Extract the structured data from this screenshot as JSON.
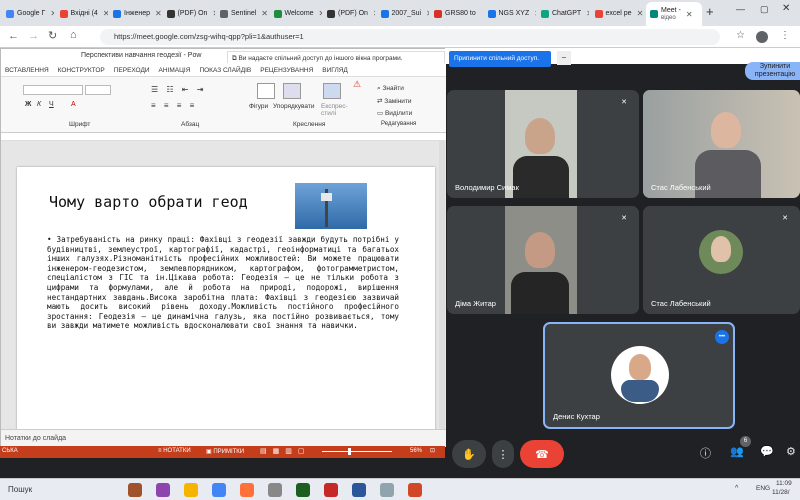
{
  "browser": {
    "tabs": [
      {
        "label": "Google Г",
        "color": "#4285f4"
      },
      {
        "label": "Вхідні (4",
        "color": "#ea4335"
      },
      {
        "label": "Інженер",
        "color": "#1a73e8"
      },
      {
        "label": "(PDF) On",
        "color": "#333333"
      },
      {
        "label": "Sentinel",
        "color": "#5f6368"
      },
      {
        "label": "Welcome",
        "color": "#1e8e3e"
      },
      {
        "label": "(PDF) On",
        "color": "#333333"
      },
      {
        "label": "2007_Sui",
        "color": "#1a73e8"
      },
      {
        "label": "GRS80 to",
        "color": "#d93025"
      },
      {
        "label": "NGS XYZ",
        "color": "#1a73e8"
      },
      {
        "label": "ChatGPT",
        "color": "#10a37f"
      },
      {
        "label": "excel pe",
        "color": "#ea4335"
      }
    ],
    "active_tab": {
      "line1": "Meet -",
      "line2": "відео"
    },
    "new_tab": "+",
    "url": "https://meet.google.com/zsg-wihq-qpp?pli=1&authuser=1"
  },
  "share_bar": {
    "text": "Ви надаєте спільний доступ до іншого вікна програми.",
    "stop_button": "Припинити спільний доступ.",
    "hide": "_"
  },
  "meet": {
    "stop_presenting": [
      "Зупинити",
      "презентацію"
    ],
    "participants": [
      {
        "name": "Володимир Симак",
        "muted": true
      },
      {
        "name": "Стас Лабенський",
        "muted": false
      },
      {
        "name": "Діма Житар",
        "muted": true
      },
      {
        "name": "Стас Лабенський",
        "muted": true
      },
      {
        "name": "Денис Кухтар",
        "muted": false
      }
    ],
    "more_menu": "•••",
    "participants_count": "6"
  },
  "ppt": {
    "title": "Перспективи навчання геодезії - Pow",
    "tabs": [
      "ВСТАВЛЕННЯ",
      "КОНСТРУКТОР",
      "ПЕРЕХОДИ",
      "АНІМАЦІЯ",
      "ПОКАЗ СЛАЙДІВ",
      "РЕЦЕНЗУВАННЯ",
      "ВИГЛЯД"
    ],
    "groups": {
      "font": "Шрифт",
      "paragraph": "Абзац",
      "drawing": "Креслення",
      "editing": "Редагування"
    },
    "buttons": {
      "shapes": "Фігури",
      "arrange": "Упорядкувати",
      "quick_styles": "Експрес-стилі",
      "find": "Знайти",
      "replace": "Замінити",
      "select": "Виділити"
    },
    "slide_title": "Чому варто обрати геод",
    "slide_body": "• Затребуваність на ринку праці: Фахівці з геодезії завжди будуть потрібні у будівництві, землеустрої, картографії, кадастрі, геоінформатиці та багатьох інших галузях.Різноманітність професійних можливостей: Ви можете працювати інженером-геодезистом, землевпорядником, картографом, фотограмметристом, спеціалістом з ГІС та ін.Цікава робота: Геодезія – це не тільки робота з цифрами та формулами, але й робота на природі, подорожі, вирішення нестандартних завдань.Висока заробітна плата: Фахівці з геодезією зазвичай мають досить високий рівень доходу.Можливість постійного професійного зростання: Геодезія – це динамічна галузь, яка постійно розвивається, тому ви завжди матимете можливість вдосконалювати свої знання та навички.",
    "notes": "Нотатки до слайда",
    "status": {
      "lang": "СЬКА",
      "notes_btn": "НОТАТКИ",
      "comments_btn": "ПРИМІТКИ",
      "zoom": "56%"
    }
  },
  "taskbar": {
    "search": "Пошук",
    "lang": "ENG",
    "time": "11:09",
    "date": "11/28/"
  },
  "accent": "#1a73e8"
}
